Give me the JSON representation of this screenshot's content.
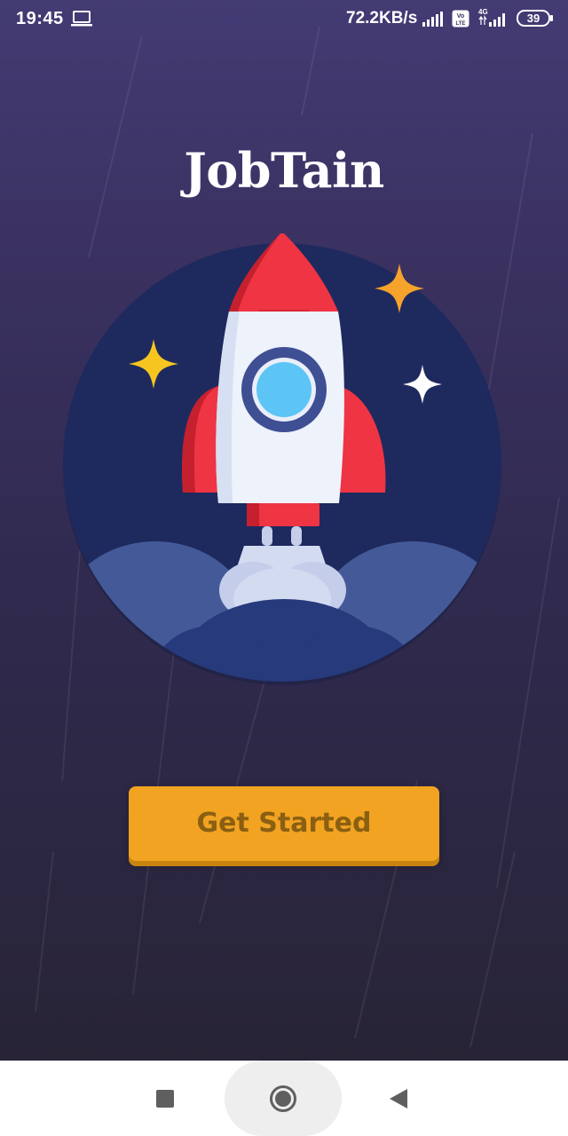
{
  "status_bar": {
    "time": "19:45",
    "network_speed": "72.2KB/s",
    "network_type": "4G",
    "volte_label": "Vo LTE",
    "battery_level": "39",
    "icons": [
      "laptop-icon",
      "signal-icon",
      "volte-icon",
      "signal-4g-icon",
      "battery-icon"
    ]
  },
  "app": {
    "title": "JobTain",
    "illustration": "rocket-launch-illustration"
  },
  "actions": {
    "get_started_label": "Get Started",
    "color": "#f2a322"
  },
  "nav_bar": {
    "icons": [
      "recents-square-icon",
      "home-circle-icon",
      "back-triangle-icon"
    ]
  },
  "colors": {
    "background_top": "#433b73",
    "background_bottom": "#282436",
    "circle": "#1e2a5e",
    "rocket_red": "#f0323f",
    "button": "#f2a322",
    "button_text": "#8a5f12"
  }
}
